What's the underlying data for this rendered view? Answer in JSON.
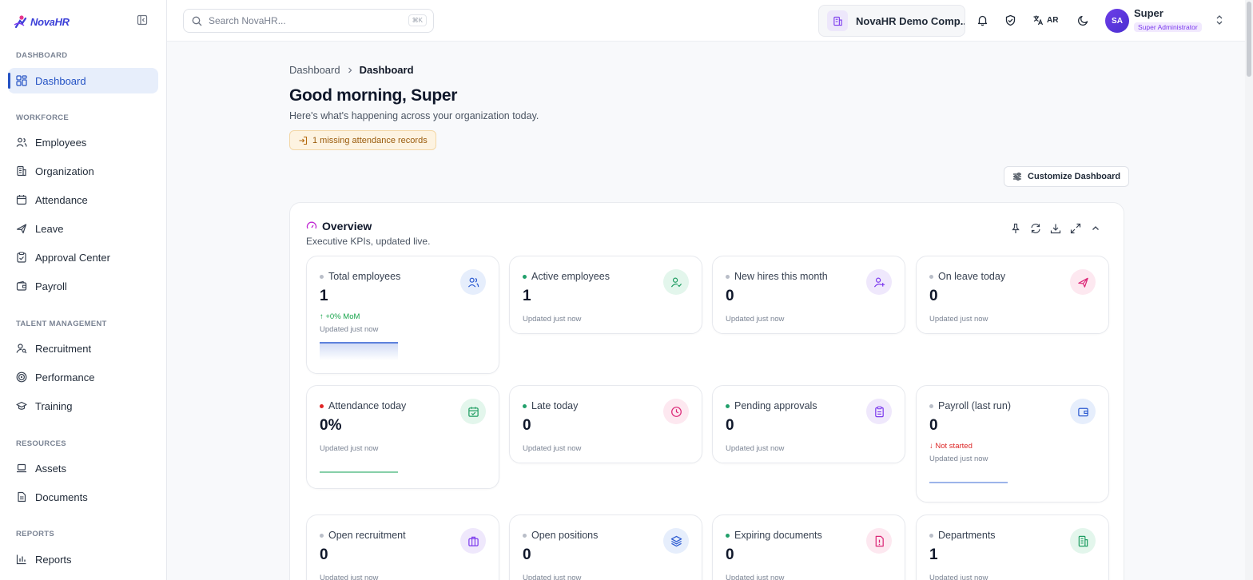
{
  "app": {
    "name": "NovaHR"
  },
  "sidebar": {
    "sections": {
      "dashboard": "DASHBOARD",
      "workforce": "WORKFORCE",
      "talent": "TALENT MANAGEMENT",
      "resources": "RESOURCES",
      "reports": "REPORTS"
    },
    "items": {
      "dashboard": "Dashboard",
      "employees": "Employees",
      "organization": "Organization",
      "attendance": "Attendance",
      "leave": "Leave",
      "approval": "Approval Center",
      "payroll": "Payroll",
      "recruitment": "Recruitment",
      "performance": "Performance",
      "training": "Training",
      "assets": "Assets",
      "documents": "Documents",
      "reports": "Reports"
    },
    "active": "dashboard"
  },
  "topbar": {
    "search_placeholder": "Search NovaHR...",
    "search_shortcut": "⌘K",
    "company": "NovaHR Demo Comp...",
    "language": "AR",
    "user": {
      "initials": "SA",
      "name": "Super",
      "role": "Super Administrator"
    }
  },
  "breadcrumb": [
    "Dashboard",
    "Dashboard"
  ],
  "page": {
    "greeting": "Good morning, Super",
    "subtitle": "Here's what's happening across your organization today.",
    "alert": "1 missing attendance records",
    "customize_label": "Customize Dashboard"
  },
  "overview": {
    "title": "Overview",
    "subtitle": "Executive KPIs, updated live.",
    "cards": [
      {
        "label": "Total employees",
        "value": "1",
        "trend": "↑ +0% MoM",
        "trend_color": "#16a34a",
        "updated": "Updated just now",
        "icon": "users-icon",
        "status": "neutral",
        "spark": "blue"
      },
      {
        "label": "Active employees",
        "value": "1",
        "updated": "Updated just now",
        "icon": "user-check-icon",
        "status": "green"
      },
      {
        "label": "New hires this month",
        "value": "0",
        "updated": "Updated just now",
        "icon": "user-plus-icon",
        "status": "neutral"
      },
      {
        "label": "On leave today",
        "value": "0",
        "updated": "Updated just now",
        "icon": "plane-icon",
        "status": "neutral"
      },
      {
        "label": "Attendance today",
        "value": "0%",
        "updated": "Updated just now",
        "icon": "calendar-check-icon",
        "status": "red",
        "spark": "green"
      },
      {
        "label": "Late today",
        "value": "0",
        "updated": "Updated just now",
        "icon": "clock-icon",
        "status": "green"
      },
      {
        "label": "Pending approvals",
        "value": "0",
        "updated": "Updated just now",
        "icon": "clipboard-icon",
        "status": "green"
      },
      {
        "label": "Payroll (last run)",
        "value": "0",
        "trend": "↓ Not started",
        "trend_color": "#dc2626",
        "updated": "Updated just now",
        "icon": "wallet-icon",
        "status": "neutral",
        "spark": "blue-flat"
      },
      {
        "label": "Open recruitment",
        "value": "0",
        "updated": "Updated just now",
        "icon": "briefcase-icon",
        "status": "neutral"
      },
      {
        "label": "Open positions",
        "value": "0",
        "updated": "Updated just now",
        "icon": "layers-icon",
        "status": "neutral"
      },
      {
        "label": "Expiring documents",
        "value": "0",
        "updated": "Updated just now",
        "icon": "file-alert-icon",
        "status": "green"
      },
      {
        "label": "Departments",
        "value": "1",
        "updated": "Updated just now",
        "icon": "building-icon",
        "status": "neutral"
      }
    ]
  },
  "colors": {
    "accent": "#2452c4",
    "brand": "#3b3fd8",
    "icon_blue_bg": "#e6eefc",
    "icon_green_bg": "#e3f6ec",
    "icon_purple_bg": "#efe8fc",
    "icon_pink_bg": "#fde8f0"
  }
}
